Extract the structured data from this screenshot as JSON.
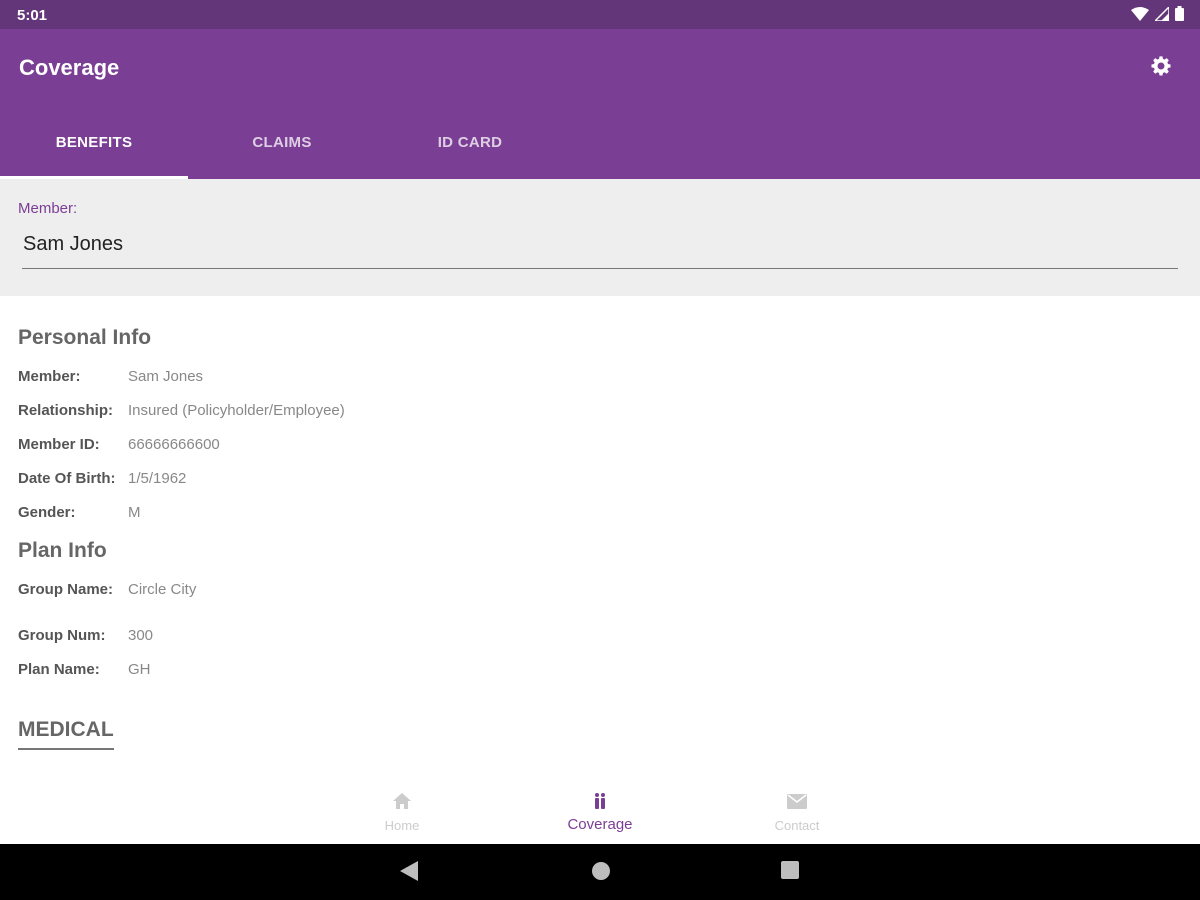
{
  "status_bar": {
    "time": "5:01",
    "icons": [
      "wifi-icon",
      "signal-icon",
      "battery-icon"
    ]
  },
  "app_bar": {
    "title": "Coverage",
    "settings_icon": "gear-icon"
  },
  "tabs": [
    {
      "label": "BENEFITS",
      "active": true
    },
    {
      "label": "CLAIMS",
      "active": false
    },
    {
      "label": "ID CARD",
      "active": false
    }
  ],
  "member_selector": {
    "label": "Member:",
    "value": "Sam Jones"
  },
  "personal_info": {
    "title": "Personal Info",
    "rows": [
      {
        "key": "Member:",
        "value": "Sam Jones"
      },
      {
        "key": "Relationship:",
        "value": "Insured (Policyholder/Employee)"
      },
      {
        "key": "Member ID:",
        "value": "66666666600"
      },
      {
        "key": "Date Of Birth:",
        "value": "1/5/1962"
      },
      {
        "key": "Gender:",
        "value": "M"
      }
    ]
  },
  "plan_info": {
    "title": "Plan Info",
    "rows": [
      {
        "key": "Group Name:",
        "value": "Circle City"
      },
      {
        "key": "Group Num:",
        "value": "300"
      },
      {
        "key": "Plan Name:",
        "value": "GH"
      }
    ]
  },
  "medical": {
    "title": "MEDICAL"
  },
  "bottom_nav": [
    {
      "label": "Home",
      "icon": "home-icon",
      "active": false
    },
    {
      "label": "Coverage",
      "icon": "family-icon",
      "active": true
    },
    {
      "label": "Contact",
      "icon": "mail-icon",
      "active": false
    }
  ],
  "colors": {
    "primary": "#7b3e95",
    "status_bar": "#63367a",
    "member_bg": "#eeeeee"
  }
}
